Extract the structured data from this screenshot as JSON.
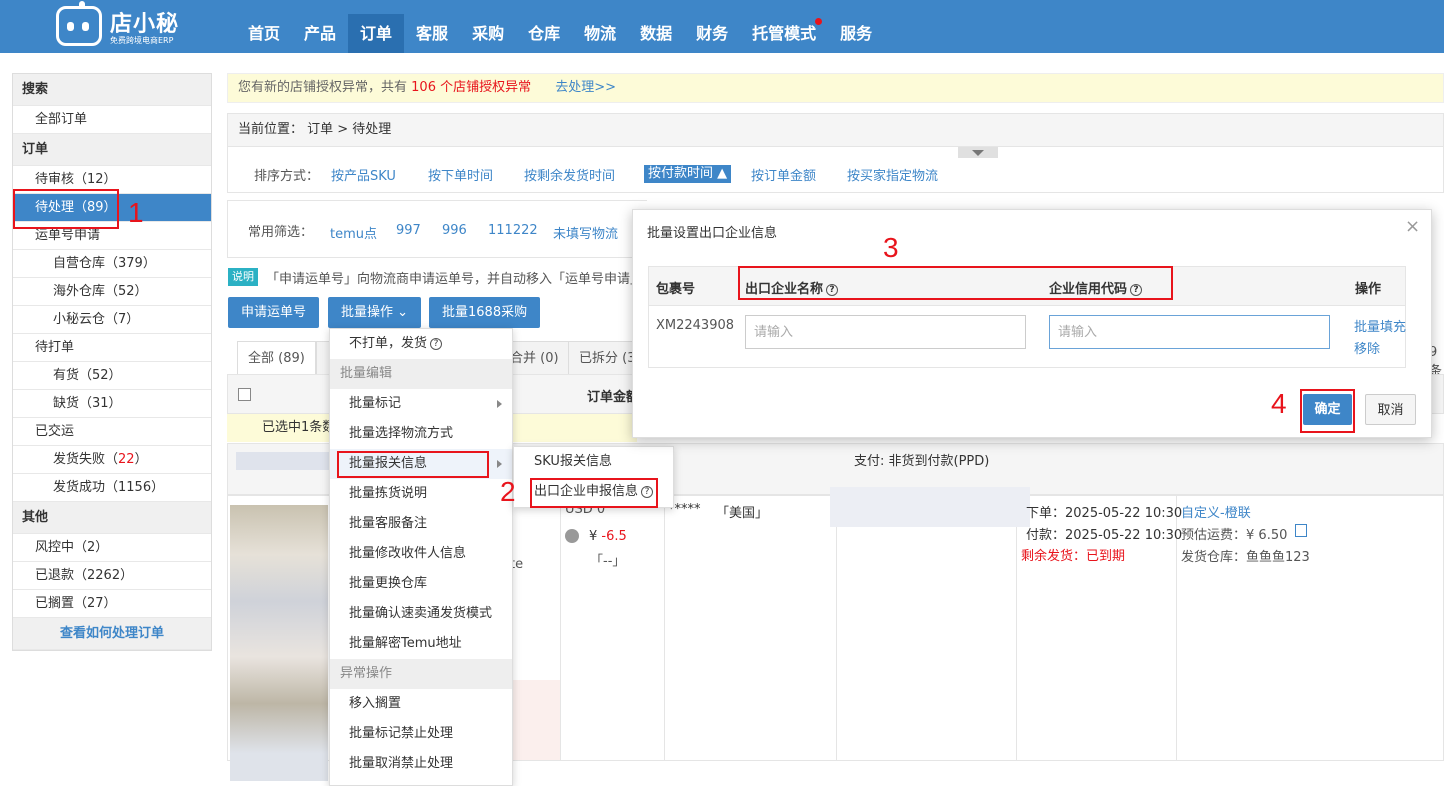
{
  "app": {
    "logo_title": "店小秘",
    "logo_subtitle": "免费跨境电商ERP",
    "nav": [
      "首页",
      "产品",
      "订单",
      "客服",
      "采购",
      "仓库",
      "物流",
      "数据",
      "财务",
      "托管模式",
      "服务"
    ]
  },
  "sidebar": {
    "search_header": "搜索",
    "all_orders": "全部订单",
    "orders_header": "订单",
    "pending_review": "待审核",
    "pending_review_count": "（12）",
    "pending_process": "待处理",
    "pending_process_count": "（89）",
    "waybill_apply": "运单号申请",
    "own_warehouse": "自营仓库",
    "own_warehouse_count": "（379）",
    "overseas_warehouse": "海外仓库",
    "overseas_warehouse_count": "（52）",
    "xiaomi_cloud": "小秘云仓",
    "xiaomi_cloud_count": "（7）",
    "to_print": "待打单",
    "in_stock": "有货",
    "in_stock_count": "（52）",
    "out_stock": "缺货",
    "out_stock_count": "（31）",
    "shipped": "已交运",
    "ship_failed": "发货失败",
    "ship_failed_count_pre": "（",
    "ship_failed_count": "22",
    "ship_failed_count_post": "）",
    "ship_success": "发货成功",
    "ship_success_count": "（1156）",
    "other_header": "其他",
    "risk_control": "风控中",
    "risk_control_count": "（2）",
    "refunded": "已退款",
    "refunded_count": "（2262）",
    "shelved": "已搁置",
    "shelved_count": "（27）",
    "howto_link": "查看如何处理订单"
  },
  "notice": {
    "text": "您有新的店铺授权异常，共有",
    "count_text": "106 个店铺授权异常",
    "action": "去处理>>"
  },
  "breadcrumb": "当前位置：  订单 > 待处理",
  "sort": {
    "label": "排序方式：",
    "options": [
      "按产品SKU",
      "按下单时间",
      "按剩余发货时间",
      "按付款时间 ▲",
      "按订单金额",
      "按买家指定物流"
    ]
  },
  "filter": {
    "label": "常用筛选：",
    "options": [
      "temu点",
      "997",
      "996",
      "111222",
      "未填写物流"
    ]
  },
  "tip": {
    "tag": "说明",
    "text": "「申请运单号」向物流商申请运单号，并自动移入「运单号申请」"
  },
  "actions": {
    "apply_waybill": "申请运单号",
    "batch_ops": "批量操作",
    "batch_1688": "批量1688采购"
  },
  "tabs": {
    "all": "全部 (89)",
    "merged": "合并 (0)",
    "split": "已拆分 (3",
    "more": "9条"
  },
  "table": {
    "amount_header": "订单金额",
    "selected_text": "已选中1条数",
    "payment": "支付: 非货到付款(PPD)"
  },
  "order": {
    "currency": "USD 0",
    "fee": "¥ -6.5",
    "fee_prefix": "¥",
    "fee_value": "-6.5",
    "bracket": "「--」",
    "buyer_mask": "*****",
    "country": "「美国」",
    "partial_te": "te",
    "order_time_label": "下单：",
    "order_time": "2025-05-22 10:30",
    "pay_time_label": "付款：",
    "pay_time": "2025-05-22 10:30",
    "remain_label": "剩余发货：",
    "remain_value": "已到期",
    "logistics": "自定义-橙联",
    "freight_label": "预估运费：",
    "freight": "¥ 6.50",
    "warehouse_label": "发货仓库：",
    "warehouse": "鱼鱼鱼123"
  },
  "dropdown": {
    "no_print_ship": "不打单，发货",
    "group_edit": "批量编辑",
    "batch_mark": "批量标记",
    "batch_logistics": "批量选择物流方式",
    "batch_customs": "批量报关信息",
    "batch_pick_note": "批量拣货说明",
    "batch_cs_note": "批量客服备注",
    "batch_receiver": "批量修改收件人信息",
    "batch_warehouse": "批量更换仓库",
    "batch_express": "批量确认速卖通发货模式",
    "batch_decrypt": "批量解密Temu地址",
    "group_exception": "异常操作",
    "move_shelve": "移入搁置",
    "batch_forbid": "批量标记禁止处理",
    "batch_unforbid": "批量取消禁止处理"
  },
  "submenu": {
    "sku_customs": "SKU报关信息",
    "export_info": "出口企业申报信息"
  },
  "modal": {
    "title": "批量设置出口企业信息",
    "close": "×",
    "col_package": "包裹号",
    "col_company": "出口企业名称",
    "col_credit": "企业信用代码",
    "col_ops": "操作",
    "package_no": "XM2243908",
    "company_placeholder": "请输入",
    "credit_placeholder": "请输入",
    "op_fill": "批量填充",
    "op_remove": "移除",
    "confirm": "确定",
    "cancel": "取消"
  },
  "annotations": [
    "1",
    "2",
    "3",
    "4"
  ],
  "colors": {
    "brand_blue": "#3e86c8",
    "annotation_red": "#e8141c",
    "notice_bg": "#fdfbd8"
  }
}
